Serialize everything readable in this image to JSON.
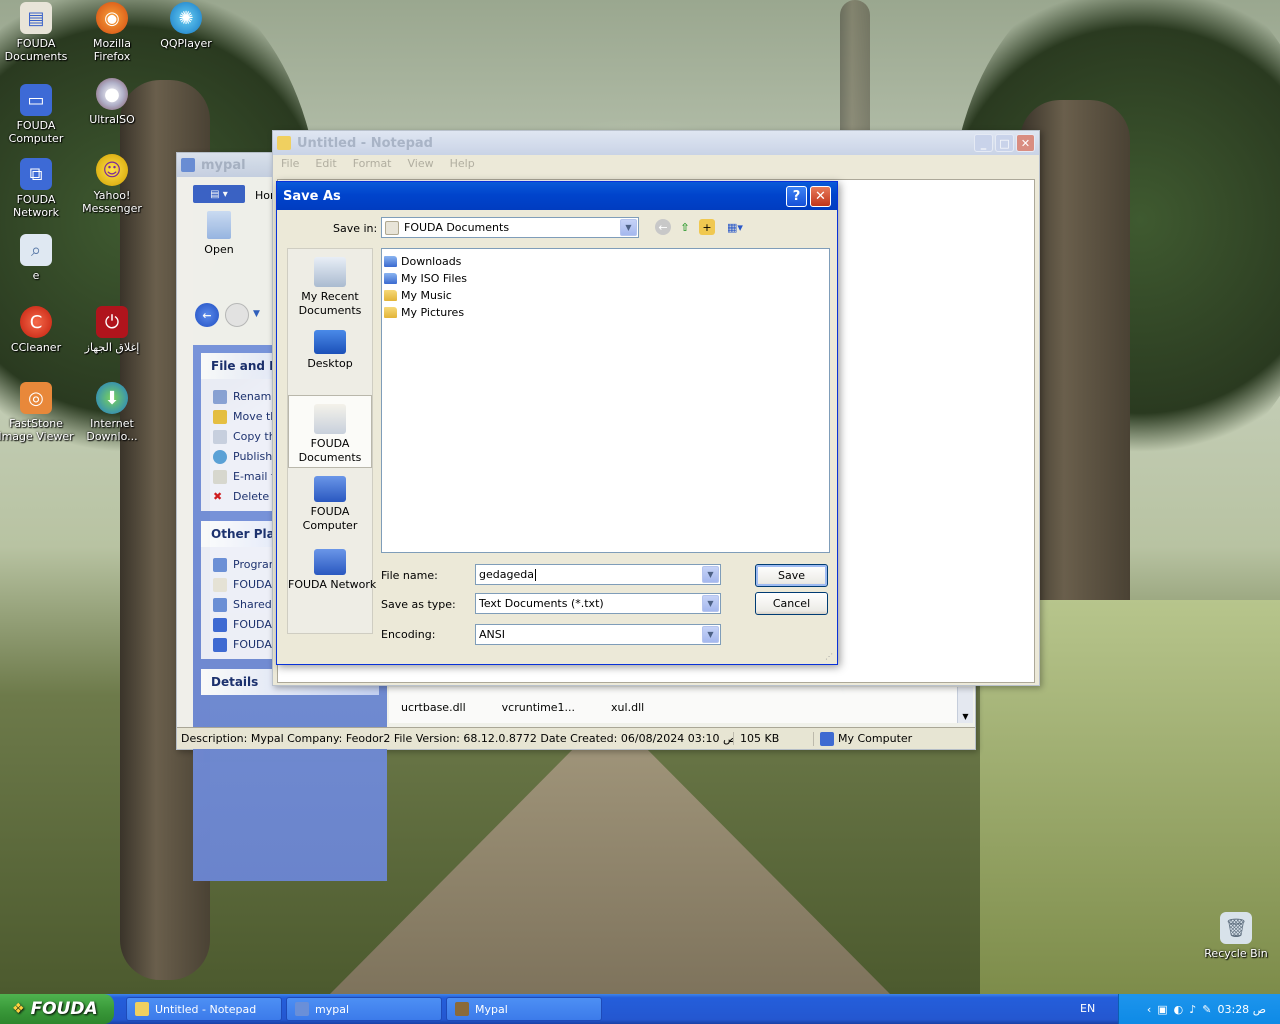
{
  "desktop": {
    "icons": [
      {
        "label": "FOUDA Documents"
      },
      {
        "label": "Mozilla Firefox"
      },
      {
        "label": "QQPlayer"
      },
      {
        "label": "FOUDA Computer"
      },
      {
        "label": "UltraISO"
      },
      {
        "label": "FOUDA Network"
      },
      {
        "label": "Yahoo! Messenger"
      },
      {
        "label": "e"
      },
      {
        "label": "CCleaner"
      },
      {
        "label": "إغلاق الجهاز"
      },
      {
        "label": "FastStone Image Viewer"
      },
      {
        "label": "Internet Downlo..."
      },
      {
        "label": "Recycle Bin"
      }
    ]
  },
  "mypal": {
    "title": "mypal",
    "toolbar_home": "Hor",
    "open_label": "Open",
    "file_tasks_title": "File and Folc",
    "file_tasks": [
      "Rename",
      "Move this",
      "Copy this",
      "Publish th",
      "E-mail thi",
      "Delete th"
    ],
    "other_places_title": "Other Place",
    "other_places": [
      "Program",
      "FOUDA D",
      "Shared D",
      "FOUDA C",
      "FOUDA N"
    ],
    "details_title": "Details",
    "files": [
      "ucrtbase.dll",
      "vcruntime1...",
      "xul.dll"
    ],
    "status_description": "Description: Mypal Company: Feodor2 File Version: 68.12.0.8772 Date Created: 06/08/2024 03:10 ص Size: 105 KB",
    "status_size": "105 KB",
    "status_location": "My Computer"
  },
  "notepad": {
    "title": "Untitled - Notepad",
    "menu": [
      "File",
      "Edit",
      "Format",
      "View",
      "Help"
    ]
  },
  "save_as": {
    "title": "Save As",
    "save_in_label": "Save in:",
    "save_in_value": "FOUDA Documents",
    "places": [
      {
        "label": "My Recent Documents"
      },
      {
        "label": "Desktop"
      },
      {
        "label": "FOUDA Documents"
      },
      {
        "label": "FOUDA Computer"
      },
      {
        "label": "FOUDA Network"
      }
    ],
    "files": [
      "Downloads",
      "My ISO Files",
      "My Music",
      "My Pictures"
    ],
    "file_name_label": "File name:",
    "file_name_value": "gedageda",
    "save_as_type_label": "Save as type:",
    "save_as_type_value": "Text Documents (*.txt)",
    "encoding_label": "Encoding:",
    "encoding_value": "ANSI",
    "save_button": "Save",
    "cancel_button": "Cancel",
    "help_button": "?",
    "close_button": "✕"
  },
  "taskbar": {
    "start_label": "FOUDA",
    "tasks": [
      {
        "label": "Untitled - Notepad"
      },
      {
        "label": "mypal"
      },
      {
        "label": "Mypal"
      }
    ],
    "language": "EN",
    "clock": "03:28 ص"
  },
  "colors": {
    "xp_blue_title": "#0044cc",
    "start_green": "#3a9a3a",
    "taskbar_blue": "#245edb"
  }
}
